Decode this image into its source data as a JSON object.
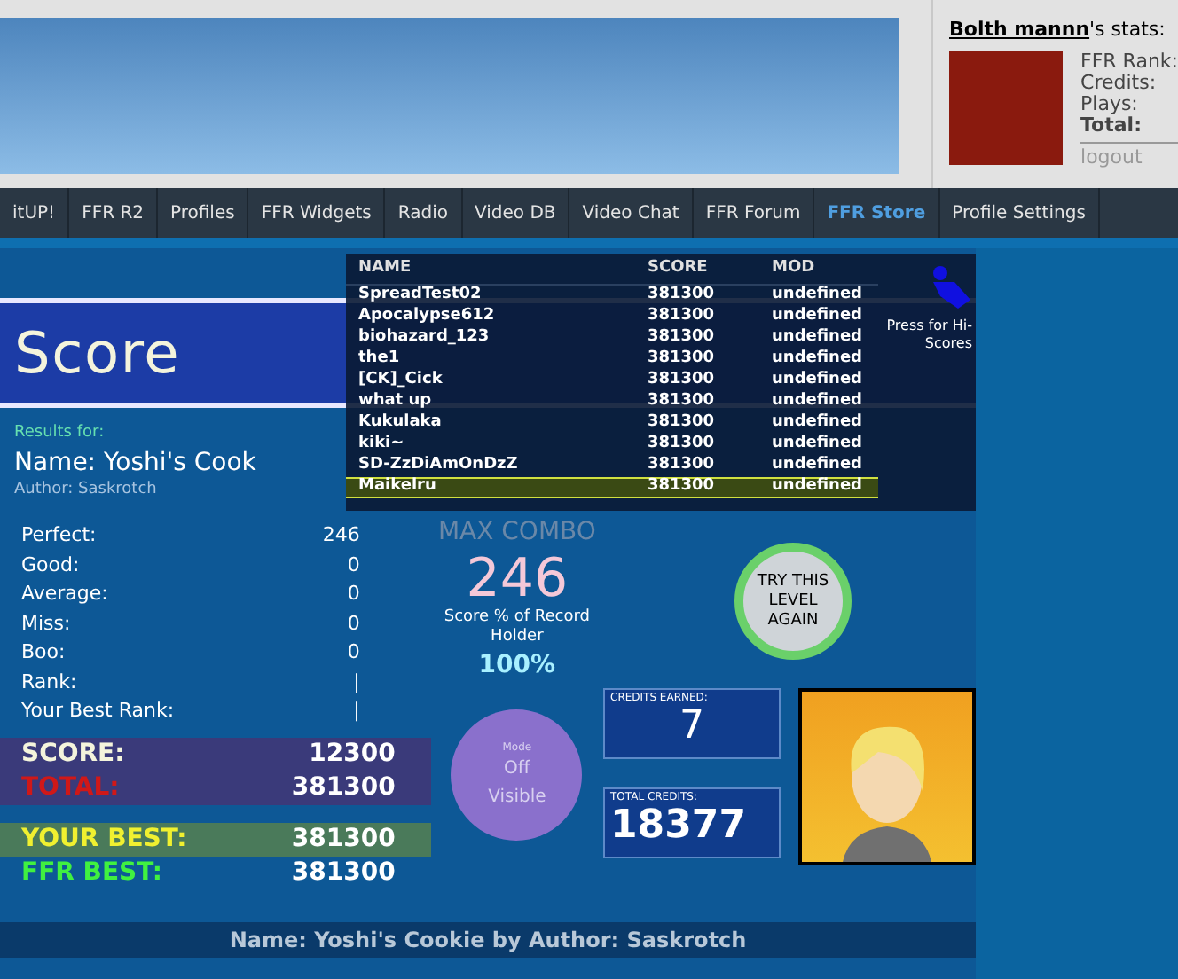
{
  "stats_panel": {
    "user": "Bolth mannn",
    "title_suffix": "'s stats:",
    "labels": [
      "FFR Rank:",
      "Credits:",
      "Plays:"
    ],
    "total_label": "Total:",
    "logout": "logout"
  },
  "nav": [
    {
      "label": "itUP!",
      "selected": false
    },
    {
      "label": "FFR R2",
      "selected": false
    },
    {
      "label": "Profiles",
      "selected": false
    },
    {
      "label": "FFR Widgets",
      "selected": false
    },
    {
      "label": "Radio",
      "selected": false
    },
    {
      "label": "Video DB",
      "selected": false
    },
    {
      "label": "Video Chat",
      "selected": false
    },
    {
      "label": "FFR Forum",
      "selected": false
    },
    {
      "label": "FFR Store",
      "selected": true
    },
    {
      "label": "Profile Settings",
      "selected": false
    }
  ],
  "game": {
    "title": "Score",
    "results_for": "Results for:",
    "song_name": "Name: Yoshi's Cook",
    "author": "Author: Saskrotch",
    "stats": [
      {
        "label": "Perfect:",
        "value": "246"
      },
      {
        "label": "Good:",
        "value": "0"
      },
      {
        "label": "Average:",
        "value": "0"
      },
      {
        "label": "Miss:",
        "value": "0"
      },
      {
        "label": "Boo:",
        "value": "0"
      },
      {
        "label": "Rank:",
        "value": "|"
      },
      {
        "label": "Your Best Rank:",
        "value": "|"
      }
    ],
    "totals": [
      {
        "kind": "score",
        "label": "SCORE:",
        "value": "12300"
      },
      {
        "kind": "total",
        "label": "TOTAL:",
        "value": "381300"
      },
      {
        "kind": "your_best",
        "label": "YOUR BEST:",
        "value": "381300"
      },
      {
        "kind": "ffr_best",
        "label": "FFR BEST:",
        "value": "381300"
      }
    ],
    "max_combo_label": "MAX COMBO",
    "max_combo": "246",
    "record_label": "Score % of Record Holder",
    "record_value": "100%",
    "mode": {
      "label": "Mode",
      "values": [
        "Off",
        "Visible"
      ]
    },
    "credits_earned_label": "CREDITS EARNED:",
    "credits_earned": "7",
    "total_credits_label": "TOTAL CREDITS:",
    "total_credits": "18377",
    "try_again": "TRY THIS LEVEL AGAIN",
    "footer": "Name: Yoshi's Cookie by Author: Saskrotch"
  },
  "leaderboard": {
    "columns": [
      "NAME",
      "SCORE",
      "MOD"
    ],
    "hint": "Press for Hi-Scores",
    "rows": [
      {
        "name": "SpreadTest02",
        "score": "381300",
        "mod": "undefined",
        "selected": false
      },
      {
        "name": "Apocalypse612",
        "score": "381300",
        "mod": "undefined",
        "selected": false
      },
      {
        "name": "biohazard_123",
        "score": "381300",
        "mod": "undefined",
        "selected": false
      },
      {
        "name": "the1",
        "score": "381300",
        "mod": "undefined",
        "selected": false
      },
      {
        "name": "[CK]_Cick",
        "score": "381300",
        "mod": "undefined",
        "selected": false
      },
      {
        "name": "what up",
        "score": "381300",
        "mod": "undefined",
        "selected": false
      },
      {
        "name": "Kukulaka",
        "score": "381300",
        "mod": "undefined",
        "selected": false
      },
      {
        "name": "kiki~",
        "score": "381300",
        "mod": "undefined",
        "selected": false
      },
      {
        "name": "SD-ZzDiAmOnDzZ",
        "score": "381300",
        "mod": "undefined",
        "selected": false
      },
      {
        "name": "Maikelru",
        "score": "381300",
        "mod": "undefined",
        "selected": true
      }
    ]
  }
}
